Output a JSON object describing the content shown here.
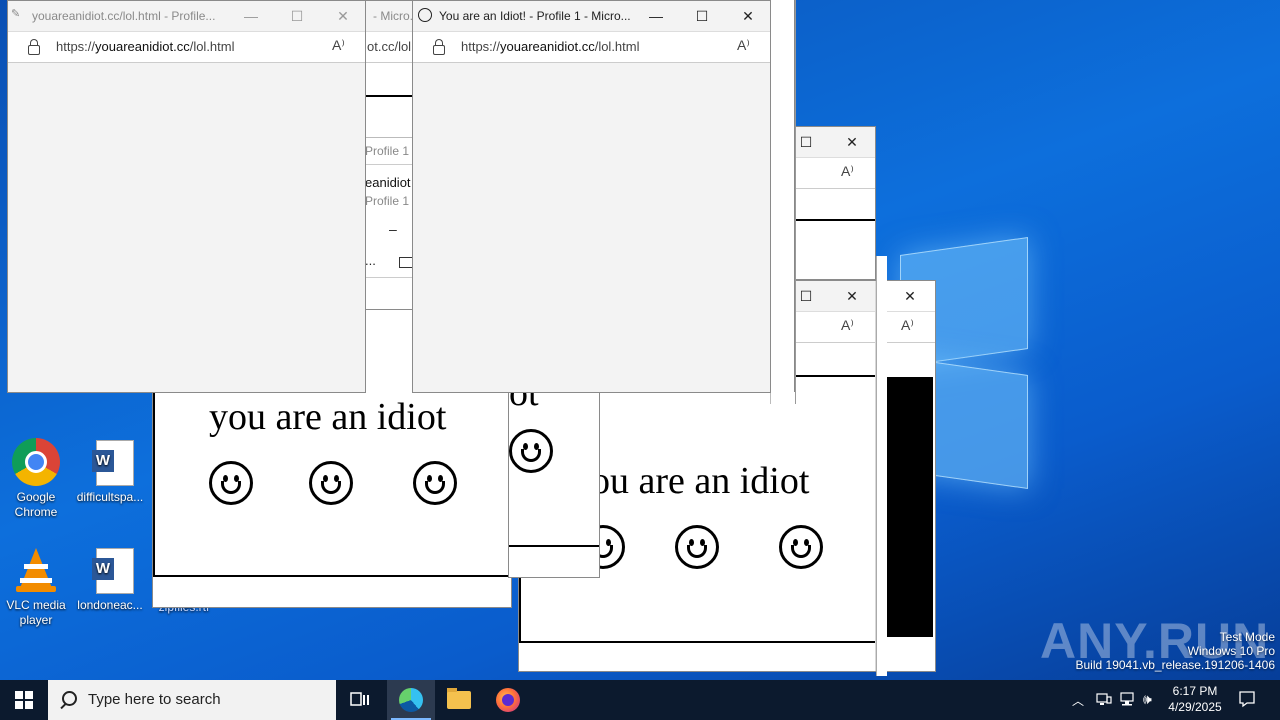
{
  "popup_front_left": {
    "title": "youareanidiot.cc/lol.html - Profile...",
    "address_host": "youareanidiot.cc",
    "address_scheme": "https://",
    "address_path": "/lol.html",
    "read_aloud": "A⁾"
  },
  "popup_front_right": {
    "title": "You are an Idiot! - Profile 1 - Micro...",
    "address_host": "youareanidiot.cc",
    "address_scheme": "https://",
    "address_path": "/lol.html",
    "read_aloud": "A⁾"
  },
  "background_fragments": {
    "micro": "- Micro...",
    "addr_partial": "ot.cc/lol",
    "profile_1a": "Profile 1 - M",
    "eanidiot": "eanidiot",
    "profile_1b": "Profile 1 -",
    "dots": "...",
    "dash": "–"
  },
  "idiot_text": "you are an idiot",
  "idiot_text_partial_left": "you are an idiot",
  "idiot_text_partial_right": "ou are an idiot",
  "idiot_text_partial_mid": "ot",
  "desktop_icons": [
    {
      "label": "Google Chrome"
    },
    {
      "label": "difficultspa..."
    },
    {
      "label": "VLC media player"
    },
    {
      "label": "londoneac..."
    },
    {
      "label": "zipfiles.rtf"
    }
  ],
  "taskbar": {
    "search_placeholder": "Type here to search",
    "clock_time": "6:17 PM",
    "clock_date": "4/29/2025"
  },
  "watermark": {
    "line1": "Test Mode",
    "line2": "Windows 10 Pro",
    "line3": "Build 19041.vb_release.191206-1406",
    "brand": "ANY.RUN"
  }
}
